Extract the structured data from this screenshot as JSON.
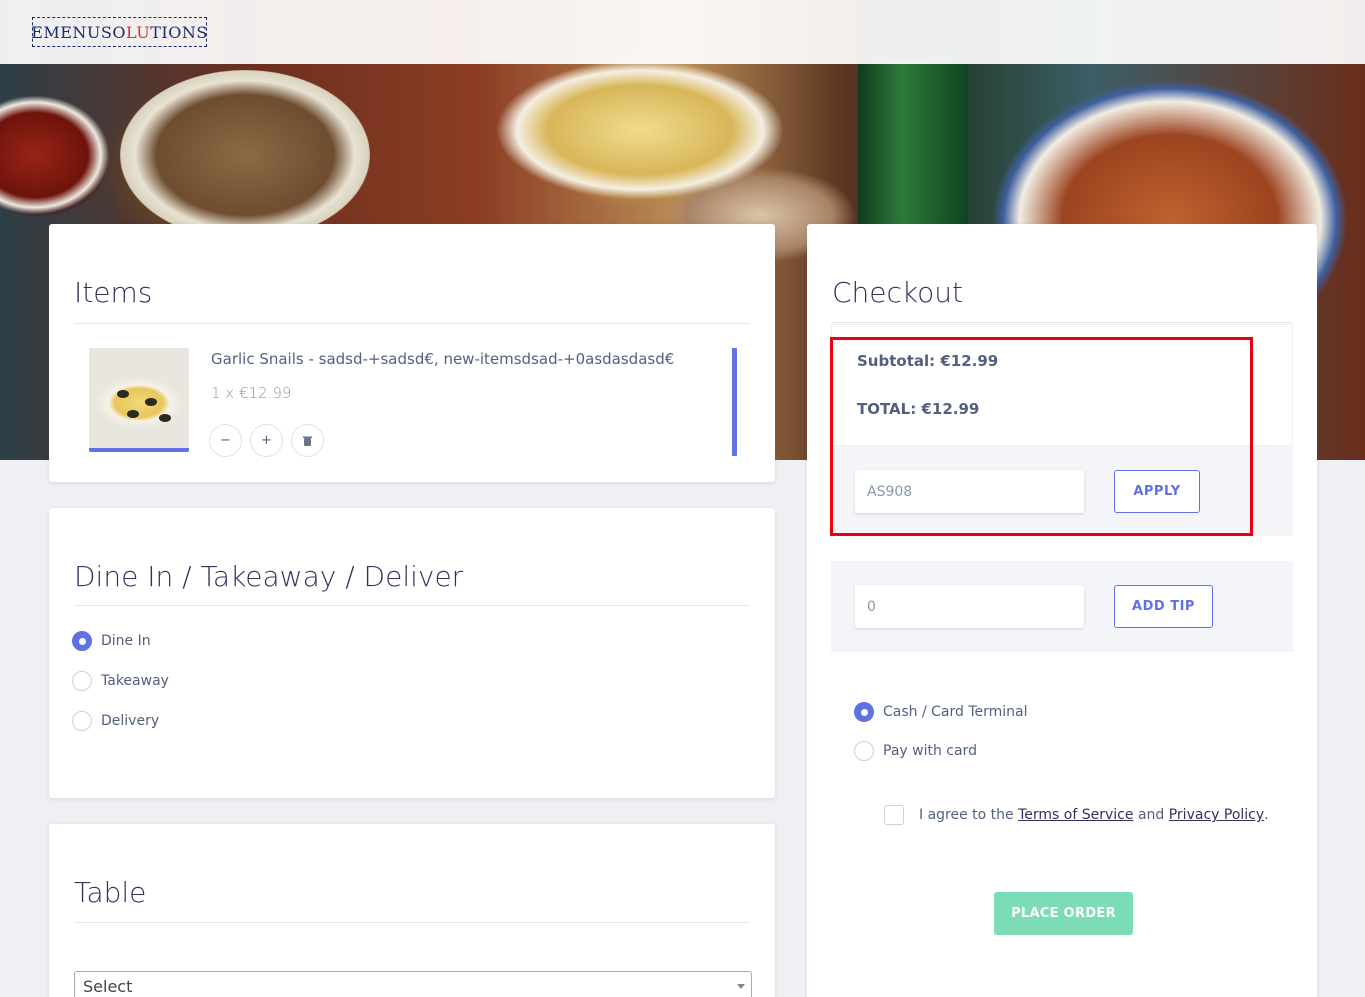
{
  "brand": {
    "logo_text_start": "EMENUSO",
    "logo_text_accent": "LU",
    "logo_text_end": "TIONS"
  },
  "items_card": {
    "title": "Items",
    "items": [
      {
        "name": "Garlic Snails - sadsd-+sadsd€, new-itemsdsad-+0asdasdasd€",
        "qty_price": "1 x €12.99"
      }
    ],
    "buttons": {
      "decrease": "−",
      "increase": "+",
      "delete": "🗑"
    }
  },
  "order_type_card": {
    "title": "Dine In / Takeaway / Deliver",
    "options": [
      "Dine In",
      "Takeaway",
      "Delivery"
    ],
    "selected": "Dine In"
  },
  "table_card": {
    "title": "Table",
    "select_value": "Select"
  },
  "checkout": {
    "title": "Checkout",
    "subtotal": "Subtotal: €12.99",
    "total": "TOTAL: €12.99",
    "coupon_value": "AS908",
    "apply_label": "APPLY",
    "tip_value": "0",
    "add_tip_label": "ADD TIP",
    "payment_options": [
      "Cash / Card Terminal",
      "Pay with card"
    ],
    "payment_selected": "Cash / Card Terminal",
    "agree_prefix": "I agree to the ",
    "terms_link": "Terms of Service",
    "agree_and": " and ",
    "privacy_link": "Privacy Policy",
    "agree_suffix": ".",
    "place_order_label": "PLACE ORDER"
  },
  "colors": {
    "primary": "#5e72e4",
    "success_light": "#7bdcb5",
    "highlight_red": "#e8000f"
  }
}
